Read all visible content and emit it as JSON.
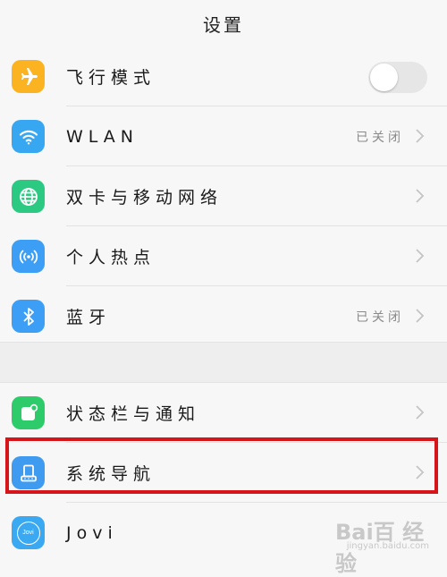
{
  "header": {
    "title": "设置"
  },
  "group1": [
    {
      "id": "airplane",
      "label": "飞行模式",
      "icon": "airplane-icon",
      "color": "#fbb321",
      "control": "toggle",
      "on": false
    },
    {
      "id": "wlan",
      "label": "WLAN",
      "icon": "wifi-icon",
      "color": "#37a7f1",
      "status": "已关闭"
    },
    {
      "id": "dualsim",
      "label": "双卡与移动网络",
      "icon": "globe-icon",
      "color": "#2bc982"
    },
    {
      "id": "hotspot",
      "label": "个人热点",
      "icon": "hotspot-icon",
      "color": "#3d9ef5"
    },
    {
      "id": "bluetooth",
      "label": "蓝牙",
      "icon": "bluetooth-icon",
      "color": "#3d9ef5",
      "status": "已关闭"
    }
  ],
  "group2": [
    {
      "id": "statusbar",
      "label": "状态栏与通知",
      "icon": "notification-icon",
      "color": "#2ecb6b"
    },
    {
      "id": "sysnav",
      "label": "系统导航",
      "icon": "navigation-icon",
      "color": "#3f9bf0"
    },
    {
      "id": "jovi",
      "label": "Jovi",
      "icon": "jovi-icon",
      "color": "#3ba9f2",
      "icon_text": "Jovi"
    }
  ],
  "watermark": {
    "text": "Bai百 经验",
    "sub": "jingyan.baidu.com"
  },
  "colors": {
    "highlight": "#d8141b",
    "chevron": "#c4c4c4"
  }
}
